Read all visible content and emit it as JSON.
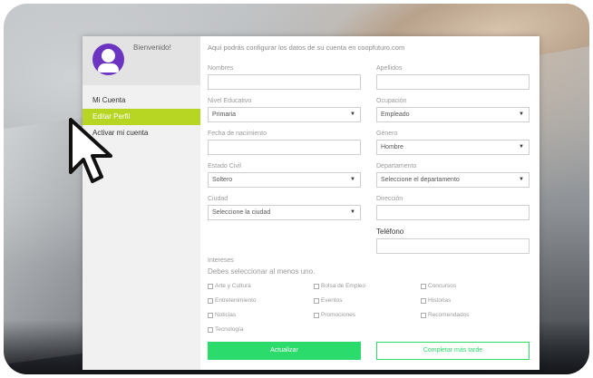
{
  "sidebar": {
    "welcome": "Bienvenido!",
    "items": [
      {
        "label": "Mi Cuenta"
      },
      {
        "label": "Editar Perfil"
      },
      {
        "label": "Activar mi cuenta"
      }
    ],
    "active_color": "#b7d624",
    "avatar_color": "#6b35c2"
  },
  "main": {
    "intro": "Aquí podrás configurar los datos de su cuenta en coopfuturo.com",
    "fields": {
      "nombres": {
        "label": "Nombres",
        "value": ""
      },
      "apellidos": {
        "label": "Apellidos",
        "value": ""
      },
      "nivel": {
        "label": "Nivel Educativo",
        "value": "Primaria"
      },
      "ocupacion": {
        "label": "Ocupación",
        "value": "Empleado"
      },
      "fecha": {
        "label": "Fecha de nacimiento",
        "value": ""
      },
      "genero": {
        "label": "Género",
        "value": "Hombre"
      },
      "estado": {
        "label": "Estado Civil",
        "value": "Soltero"
      },
      "departamento": {
        "label": "Departamento",
        "value": "Seleccione el departamento"
      },
      "ciudad": {
        "label": "Ciudad",
        "value": "Seleccione la ciudad"
      },
      "direccion": {
        "label": "Dirección",
        "value": ""
      },
      "telefono": {
        "label": "Teléfono",
        "value": ""
      }
    },
    "interests": {
      "title": "Intereses",
      "subtitle": "Debes seleccionar al menos uno.",
      "options": [
        "Arte y Cultura",
        "Bolsa de Empleo",
        "Concursos",
        "Entretenimiento",
        "Eventos",
        "Historias",
        "Noticias",
        "Promociones",
        "Recomendados",
        "Tecnología"
      ]
    },
    "buttons": {
      "update": "Actualizar",
      "later": "Completar más tarde"
    },
    "accent_color": "#2bdc6c"
  }
}
